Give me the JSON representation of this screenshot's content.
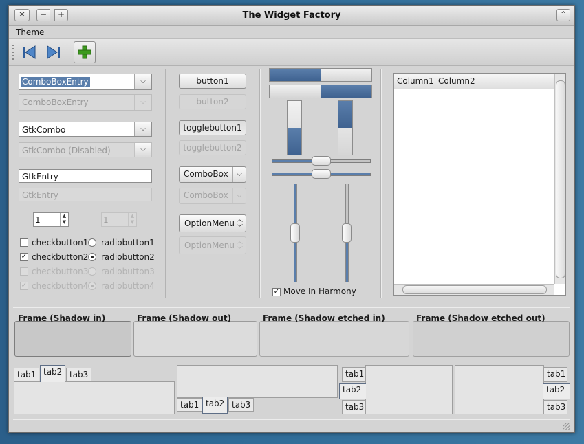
{
  "window": {
    "title": "The Widget Factory",
    "close_glyph": "✕",
    "minimize_glyph": "−",
    "maximize_glyph": "+",
    "shade_glyph": "⌃"
  },
  "menubar": {
    "items": [
      "Theme"
    ]
  },
  "toolbar": {
    "icons": [
      "go-first-icon",
      "go-last-icon",
      "add-icon"
    ]
  },
  "col1": {
    "combo_entry_1": "ComboBoxEntry",
    "combo_entry_2": "ComboBoxEntry",
    "gtk_combo_1": "GtkCombo",
    "gtk_combo_2": "GtkCombo (Disabled)",
    "entry_1": "GtkEntry",
    "entry_2": "GtkEntry",
    "spin_1": "1",
    "spin_2": "1",
    "check_1": "checkbutton1",
    "check_2": "checkbutton2",
    "check_3": "checkbutton3",
    "check_4": "checkbutton4",
    "radio_1": "radiobutton1",
    "radio_2": "radiobutton2",
    "radio_3": "radiobutton3",
    "radio_4": "radiobutton4",
    "check_mark": "✓"
  },
  "col2": {
    "button1": "button1",
    "button2": "button2",
    "toggle1": "togglebutton1",
    "toggle2": "togglebutton2",
    "combobox1": "ComboBox",
    "combobox2": "ComboBox",
    "option1": "OptionMenu",
    "option2": "OptionMenu"
  },
  "col3": {
    "progress_h1": 0.5,
    "progress_h2": 0.5,
    "progress_v1": 0.5,
    "progress_v2": 0.5,
    "scale_h1": 0.5,
    "scale_h2": 0.5,
    "scale_v1": 0.5,
    "scale_v2": 0.5,
    "harmony_label": "Move In Harmony"
  },
  "treeview": {
    "columns": [
      "Column1",
      "Column2"
    ]
  },
  "frames": [
    "Frame (Shadow in)",
    "Frame (Shadow out)",
    "Frame (Shadow etched in)",
    "Frame (Shadow etched out)"
  ],
  "notebooks": {
    "tabs": [
      "tab1",
      "tab2",
      "tab3"
    ],
    "active": "tab2"
  },
  "colors": {
    "accent": "#5a7eab",
    "accent_dark": "#3f6290",
    "window_bg": "#d4d4d4",
    "desktop_bg": "#2f6b97",
    "toolbar_add": "#3c9a1e"
  }
}
